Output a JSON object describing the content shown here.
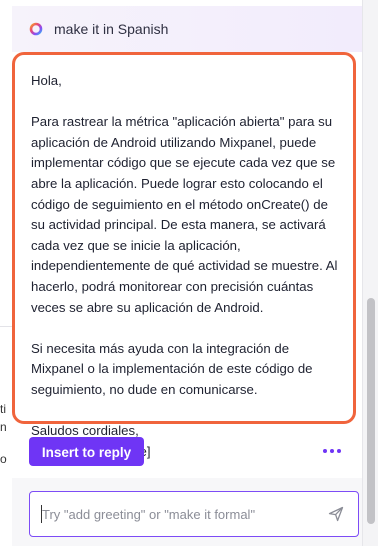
{
  "underlay": {
    "fragments": [
      "ti",
      "n",
      "o"
    ]
  },
  "header": {
    "title": "make it in Spanish",
    "logo_icon": "ai-ring-icon"
  },
  "message": {
    "text": "Hola,\n\nPara rastrear la métrica \"aplicación abierta\" para su aplicación de Android utilizando Mixpanel, puede implementar código que se ejecute cada vez que se abre la aplicación. Puede lograr esto colocando el código de seguimiento en el método onCreate() de su actividad principal. De esta manera, se activará cada vez que se inicie la aplicación, independientemente de qué actividad se muestre. Al hacerlo, podrá monitorear con precisión cuántas veces se abre su aplicación de Android.\n\nSi necesita más ayuda con la integración de Mixpanel o la implementación de este código de seguimiento, no dude en comunicarse.\n\nSaludos cordiales,\n[Nombre del agente]",
    "border_color": "#f0643c"
  },
  "actions": {
    "insert_label": "Insert to reply",
    "more_icon": "more-horizontal-icon",
    "accent_color": "#6f35f5"
  },
  "composer": {
    "placeholder": "Try \"add greeting\" or \"make it formal\"",
    "value": "",
    "send_icon": "send-icon"
  }
}
